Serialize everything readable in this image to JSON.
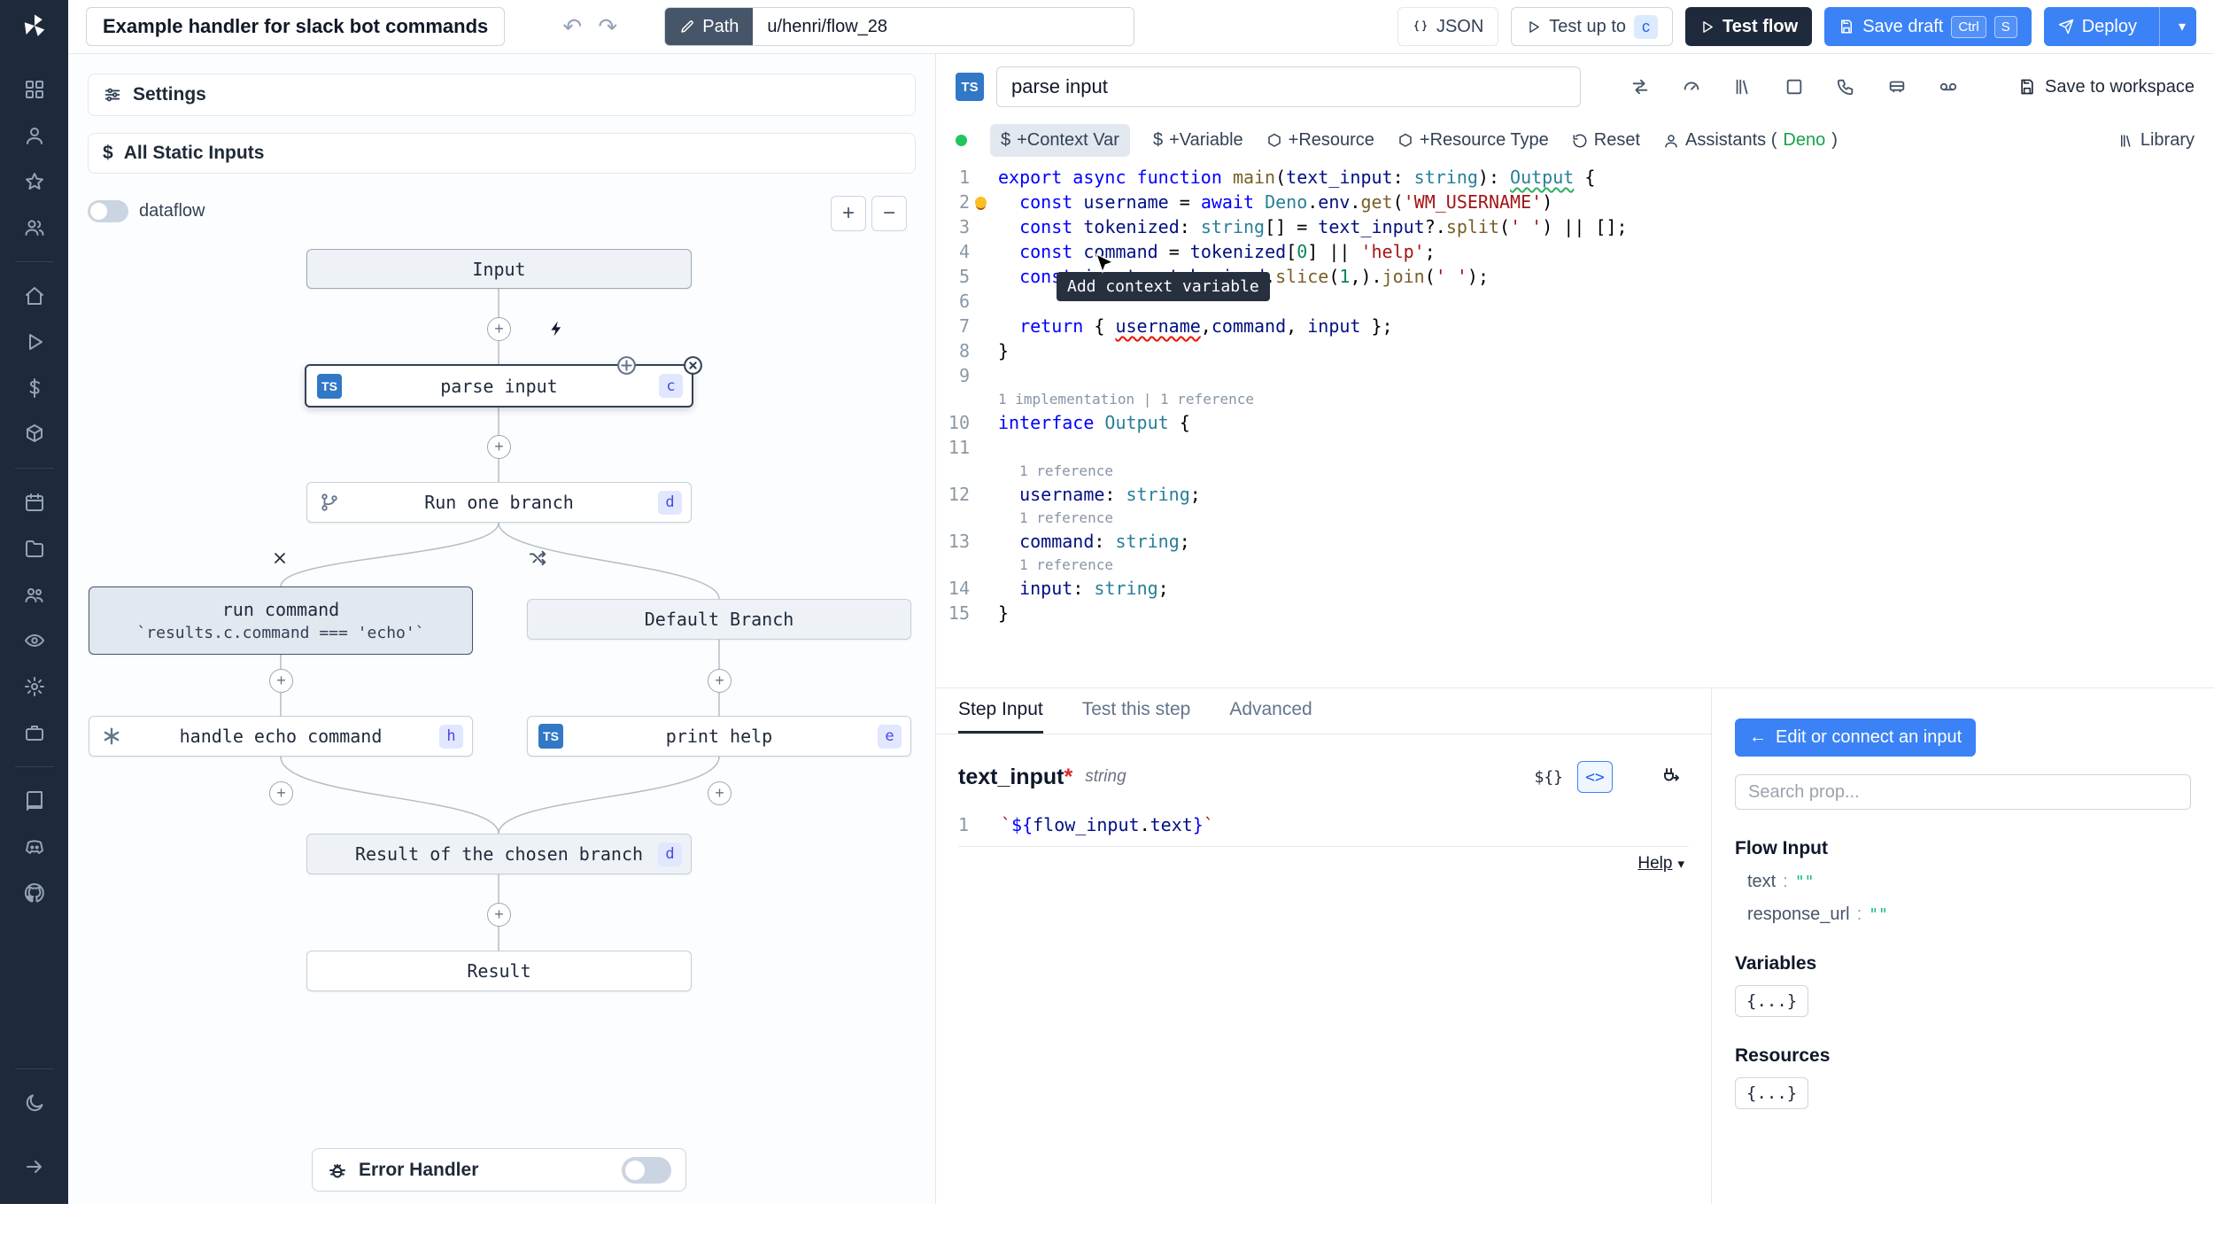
{
  "topbar": {
    "title": "Example handler for slack bot commands",
    "path_label": "Path",
    "path_value": "u/henri/flow_28",
    "json_label": "JSON",
    "test_up_to_label": "Test up to",
    "test_up_to_badge": "c",
    "test_flow_label": "Test flow",
    "save_draft_label": "Save draft",
    "kbd_ctrl": "Ctrl",
    "kbd_s": "S",
    "deploy_label": "Deploy"
  },
  "left": {
    "settings": "Settings",
    "static_inputs": "All Static Inputs",
    "dataflow": "dataflow",
    "zoom_in": "+",
    "zoom_out": "−",
    "error_handler": "Error Handler",
    "nodes": {
      "input": "Input",
      "parse_input": "parse input",
      "parse_badge": "c",
      "ts_badge": "TS",
      "run_one_branch": "Run one branch",
      "run_one_badge": "d",
      "run_command_title": "run command",
      "run_command_sub": "`results.c.command === 'echo'`",
      "default_branch": "Default Branch",
      "handle_echo": "handle echo command",
      "handle_echo_badge": "h",
      "print_help": "print help",
      "print_help_badge": "e",
      "result_chosen": "Result of the chosen branch",
      "result_chosen_badge": "d",
      "result": "Result"
    }
  },
  "editor": {
    "step_name": "parse input",
    "ts_badge": "TS",
    "save_to_workspace": "Save to workspace",
    "toolbar": {
      "context_var": "+Context Var",
      "variable": "+Variable",
      "resource": "+Resource",
      "resource_type": "+Resource Type",
      "reset": "Reset",
      "assistants_prefix": "Assistants (",
      "assistants_lang": "Deno",
      "assistants_suffix": ")",
      "library": "Library"
    },
    "tooltip": "Add context variable",
    "code": [
      {
        "no": "1",
        "seg": [
          [
            "k",
            "export"
          ],
          [
            "p",
            " "
          ],
          [
            "k",
            "async"
          ],
          [
            "p",
            " "
          ],
          [
            "k",
            "function"
          ],
          [
            "p",
            " "
          ],
          [
            "f",
            "main"
          ],
          [
            "p",
            "("
          ],
          [
            "v",
            "text_input"
          ],
          [
            "p",
            ": "
          ],
          [
            "t",
            "string"
          ],
          [
            "p",
            "): "
          ],
          [
            "g",
            "Output"
          ],
          [
            "p",
            " {"
          ]
        ]
      },
      {
        "no": "2",
        "bulb": true,
        "seg": [
          [
            "p",
            "  "
          ],
          [
            "k",
            "const"
          ],
          [
            "p",
            " "
          ],
          [
            "v",
            "username"
          ],
          [
            "p",
            " = "
          ],
          [
            "k",
            "await"
          ],
          [
            "p",
            " "
          ],
          [
            "t",
            "Deno"
          ],
          [
            "p",
            "."
          ],
          [
            "v",
            "env"
          ],
          [
            "p",
            "."
          ],
          [
            "f",
            "get"
          ],
          [
            "p",
            "("
          ],
          [
            "s",
            "'WM_USERNAME'"
          ],
          [
            "p",
            ")"
          ]
        ]
      },
      {
        "no": "3",
        "seg": [
          [
            "p",
            "  "
          ],
          [
            "k",
            "const"
          ],
          [
            "p",
            " "
          ],
          [
            "v",
            "tokenized"
          ],
          [
            "p",
            ": "
          ],
          [
            "t",
            "string"
          ],
          [
            "p",
            "[] = "
          ],
          [
            "v",
            "text_input"
          ],
          [
            "p",
            "?."
          ],
          [
            "f",
            "split"
          ],
          [
            "p",
            "("
          ],
          [
            "s",
            "' '"
          ],
          [
            "p",
            ") || [];"
          ]
        ]
      },
      {
        "no": "4",
        "seg": [
          [
            "p",
            "  "
          ],
          [
            "k",
            "const"
          ],
          [
            "p",
            " "
          ],
          [
            "v",
            "command"
          ],
          [
            "p",
            " = "
          ],
          [
            "v",
            "tokenized"
          ],
          [
            "p",
            "["
          ],
          [
            "n",
            "0"
          ],
          [
            "p",
            "] || "
          ],
          [
            "s",
            "'help'"
          ],
          [
            "p",
            ";"
          ]
        ]
      },
      {
        "no": "5",
        "seg": [
          [
            "p",
            "  "
          ],
          [
            "k",
            "const"
          ],
          [
            "p",
            " "
          ],
          [
            "v",
            "input"
          ],
          [
            "p",
            " = "
          ],
          [
            "v",
            "tokenized"
          ],
          [
            "p",
            "."
          ],
          [
            "f",
            "slice"
          ],
          [
            "p",
            "("
          ],
          [
            "n",
            "1"
          ],
          [
            "p",
            ",)."
          ],
          [
            "f",
            "join"
          ],
          [
            "p",
            "("
          ],
          [
            "s",
            "' '"
          ],
          [
            "p",
            ");"
          ]
        ]
      },
      {
        "no": "6",
        "seg": []
      },
      {
        "no": "7",
        "seg": [
          [
            "p",
            "  "
          ],
          [
            "k",
            "return"
          ],
          [
            "p",
            " { "
          ],
          [
            "e",
            "username"
          ],
          [
            "p",
            ","
          ],
          [
            "v",
            "command"
          ],
          [
            "p",
            ", "
          ],
          [
            "v",
            "input"
          ],
          [
            "p",
            " };"
          ]
        ]
      },
      {
        "no": "8",
        "seg": [
          [
            "p",
            "}"
          ]
        ]
      },
      {
        "no": "9",
        "seg": []
      },
      {
        "lens": "1 implementation | 1 reference",
        "pad": 0
      },
      {
        "no": "10",
        "seg": [
          [
            "k",
            "interface"
          ],
          [
            "p",
            " "
          ],
          [
            "t",
            "Output"
          ],
          [
            "p",
            " {"
          ]
        ]
      },
      {
        "no": "11",
        "seg": []
      },
      {
        "lens": "1 reference",
        "pad": 24
      },
      {
        "no": "12",
        "seg": [
          [
            "p",
            "  "
          ],
          [
            "v",
            "username"
          ],
          [
            "p",
            ": "
          ],
          [
            "t",
            "string"
          ],
          [
            "p",
            ";"
          ]
        ]
      },
      {
        "lens": "1 reference",
        "pad": 24
      },
      {
        "no": "13",
        "seg": [
          [
            "p",
            "  "
          ],
          [
            "v",
            "command"
          ],
          [
            "p",
            ": "
          ],
          [
            "t",
            "string"
          ],
          [
            "p",
            ";"
          ]
        ]
      },
      {
        "lens": "1 reference",
        "pad": 24
      },
      {
        "no": "14",
        "seg": [
          [
            "p",
            "  "
          ],
          [
            "v",
            "input"
          ],
          [
            "p",
            ": "
          ],
          [
            "t",
            "string"
          ],
          [
            "p",
            ";"
          ]
        ]
      },
      {
        "no": "15",
        "seg": [
          [
            "p",
            "}"
          ]
        ]
      }
    ]
  },
  "bottom": {
    "tabs": [
      "Step Input",
      "Test this step",
      "Advanced"
    ],
    "field_name": "text_input",
    "field_required": "*",
    "field_type": "string",
    "dollar_brace": "${}",
    "code_toggle": "<>",
    "expr_line_no": "1",
    "expr": [
      [
        "s",
        "`"
      ],
      [
        "k",
        "${"
      ],
      [
        "v",
        "flow_input"
      ],
      [
        "p",
        "."
      ],
      [
        "v",
        "text"
      ],
      [
        "k",
        "}"
      ],
      [
        "s",
        "`"
      ]
    ],
    "help": "Help"
  },
  "props": {
    "connect_btn": "Edit or connect an input",
    "connect_arrow": "←",
    "search_placeholder": "Search prop...",
    "flow_input_title": "Flow Input",
    "items": [
      {
        "key": "text",
        "sep": ":",
        "value": "\"\""
      },
      {
        "key": "response_url",
        "sep": ":",
        "value": "\"\""
      }
    ],
    "variables_title": "Variables",
    "variables_btn": "{...}",
    "resources_title": "Resources",
    "resources_btn": "{...}"
  }
}
